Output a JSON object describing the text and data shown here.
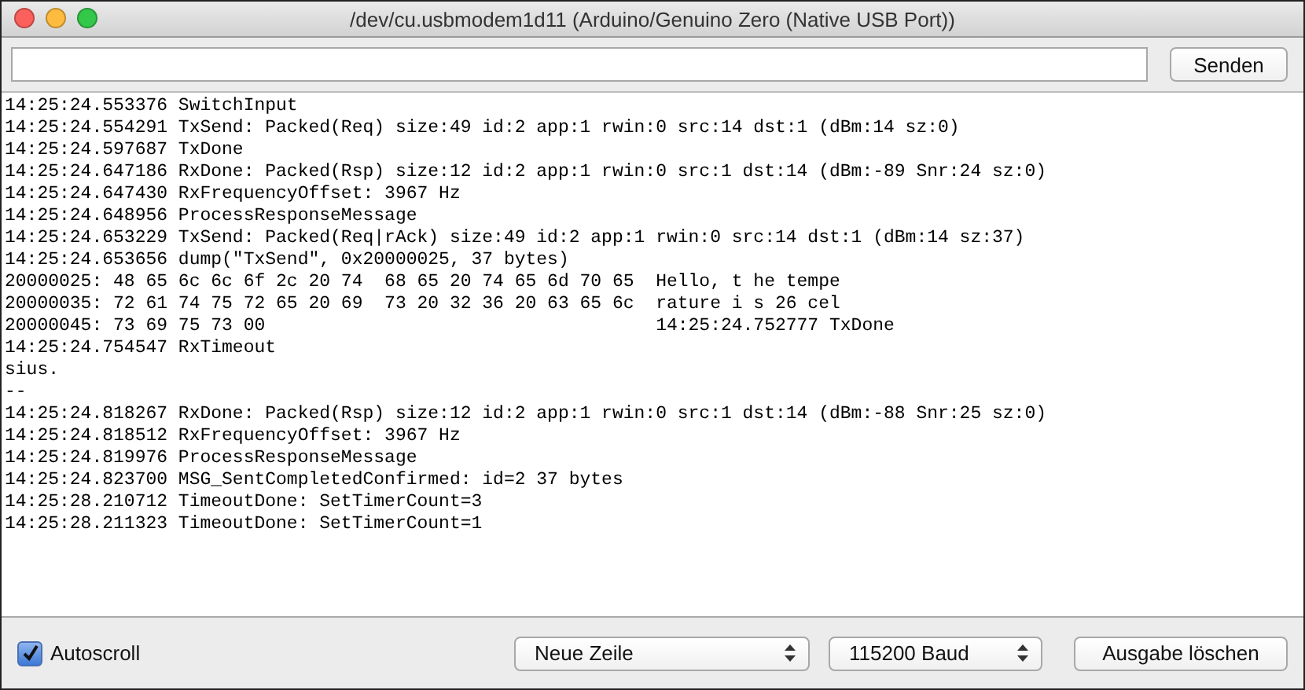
{
  "window": {
    "title": "/dev/cu.usbmodem1d11 (Arduino/Genuino Zero (Native USB Port))"
  },
  "send_button": "Senden",
  "output_lines": [
    "14:25:24.553376 SwitchInput",
    "14:25:24.554291 TxSend: Packed(Req) size:49 id:2 app:1 rwin:0 src:14 dst:1 (dBm:14 sz:0)",
    "14:25:24.597687 TxDone",
    "14:25:24.647186 RxDone: Packed(Rsp) size:12 id:2 app:1 rwin:0 src:1 dst:14 (dBm:-89 Snr:24 sz:0)",
    "14:25:24.647430 RxFrequencyOffset: 3967 Hz",
    "14:25:24.648956 ProcessResponseMessage",
    "14:25:24.653229 TxSend: Packed(Req|rAck) size:49 id:2 app:1 rwin:0 src:14 dst:1 (dBm:14 sz:37)",
    "14:25:24.653656 dump(\"TxSend\", 0x20000025, 37 bytes)",
    "20000025: 48 65 6c 6c 6f 2c 20 74  68 65 20 74 65 6d 70 65  Hello, t he tempe",
    "20000035: 72 61 74 75 72 65 20 69  73 20 32 36 20 63 65 6c  rature i s 26 cel",
    "20000045: 73 69 75 73 00                                    14:25:24.752777 TxDone",
    "14:25:24.754547 RxTimeout",
    "sius.",
    "--",
    "14:25:24.818267 RxDone: Packed(Rsp) size:12 id:2 app:1 rwin:0 src:1 dst:14 (dBm:-88 Snr:25 sz:0)",
    "14:25:24.818512 RxFrequencyOffset: 3967 Hz",
    "14:25:24.819976 ProcessResponseMessage",
    "14:25:24.823700 MSG_SentCompletedConfirmed: id=2 37 bytes",
    "14:25:28.210712 TimeoutDone: SetTimerCount=3",
    "14:25:28.211323 TimeoutDone: SetTimerCount=1"
  ],
  "autoscroll": {
    "label": "Autoscroll",
    "checked": true
  },
  "line_ending_select": "Neue Zeile",
  "baud_select": "115200 Baud",
  "clear_button": "Ausgabe löschen"
}
